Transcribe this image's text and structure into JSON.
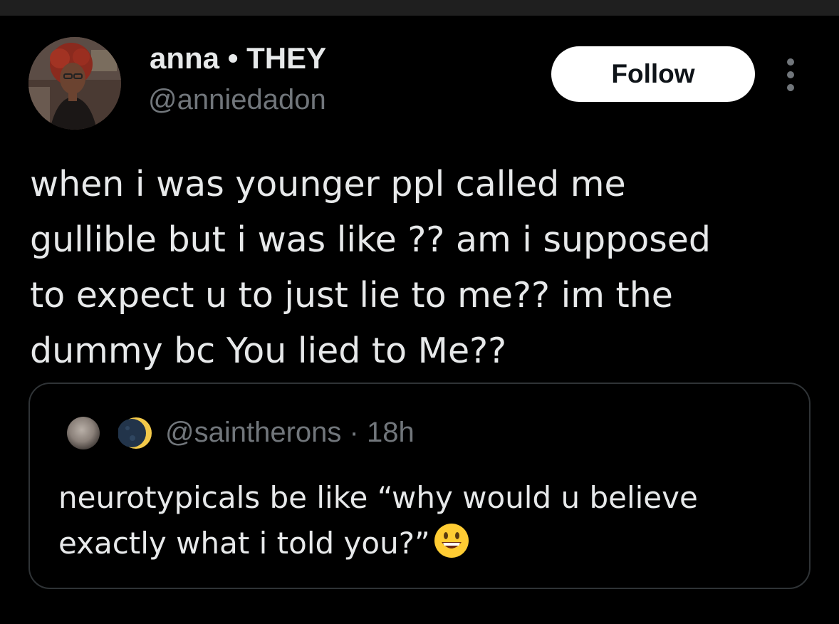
{
  "author": {
    "display_name": "anna • THEY",
    "handle": "@anniedadon",
    "avatar_icon": "profile-photo"
  },
  "actions": {
    "follow_label": "Follow",
    "more_icon": "more-vertical-icon"
  },
  "tweet": {
    "text": "when i was younger ppl called me\ngullible but i was like ?? am i supposed\nto expect u to just lie to me?? im the\ndummy bc You lied to Me??"
  },
  "quoted_tweet": {
    "handle_time": "@saintherons · 18h",
    "name_icons": [
      "full-moon-avatar",
      "crescent-moon-emoji"
    ],
    "text": "neurotypicals be like “why would u believe\nexactly what i told you?”",
    "trailing_emoji": "grinning-face-emoji"
  },
  "colors": {
    "background": "#000000",
    "primary_text": "#e7e9ea",
    "secondary_text": "#71767b",
    "border": "#2f3336",
    "button_bg": "#ffffff"
  }
}
